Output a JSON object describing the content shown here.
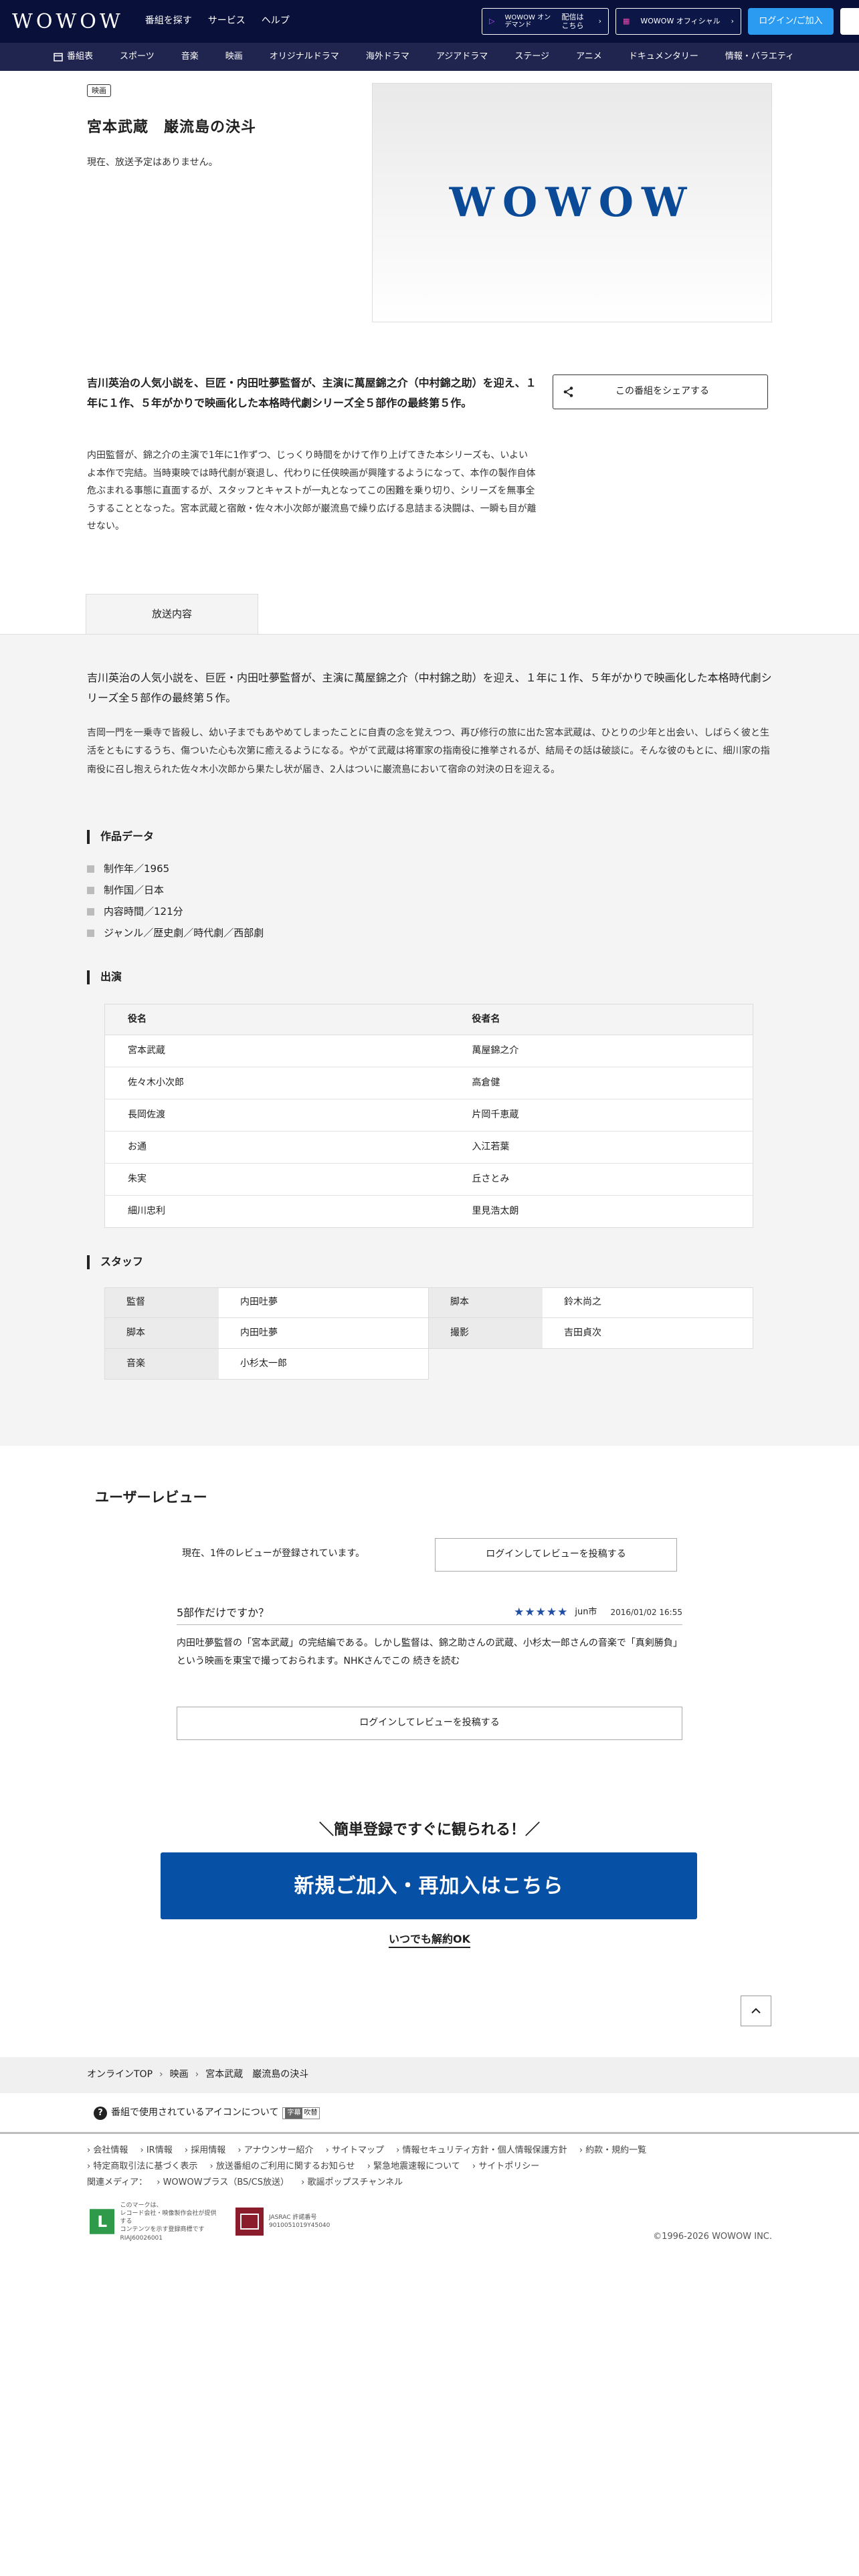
{
  "header": {
    "logo": "WOWOW",
    "nav": [
      "番組を探す",
      "サービス",
      "ヘルプ"
    ],
    "ondemand_brand": "WOWOW オンデマンド",
    "ondemand_label": "配信は\nこちら",
    "shop_label": "WOWOW オフィシャル",
    "login_label": "ログイン/ご加入"
  },
  "subnav": [
    "番組表",
    "スポーツ",
    "音楽",
    "映画",
    "オリジナルドラマ",
    "海外ドラマ",
    "アジアドラマ",
    "ステージ",
    "アニメ",
    "ドキュメンタリー",
    "情報・バラエティ"
  ],
  "program": {
    "genre_tag": "映画",
    "title": "宮本武蔵　巌流島の決斗",
    "schedule": "現在、放送予定はありません。",
    "hero_logo": "WOWOW",
    "lead": "吉川英治の人気小説を、巨匠・内田吐夢監督が、主演に萬屋錦之介（中村錦之助）を迎え、１年に１作、５年がかりで映画化した本格時代劇シリーズ全５部作の最終第５作。",
    "body": "内田監督が、錦之介の主演で1年に1作ずつ、じっくり時間をかけて作り上げてきた本シリーズも、いよいよ本作で完結。当時東映では時代劇が衰退し、代わりに任侠映画が興隆するようになって、本作の製作自体危ぶまれる事態に直面するが、スタッフとキャストが一丸となってこの困難を乗り切り、シリーズを無事全うすることとなった。宮本武蔵と宿敵・佐々木小次郎が巌流島で繰り広げる息詰まる決闘は、一瞬も目が離せない。",
    "share_label": "この番組をシェアする",
    "tab_label": "放送内容"
  },
  "detail": {
    "intro_lead": "吉川英治の人気小説を、巨匠・内田吐夢監督が、主演に萬屋錦之介（中村錦之助）を迎え、１年に１作、５年がかりで映画化した本格時代劇シリーズ全５部作の最終第５作。",
    "intro_body": "吉岡一門を一乗寺で皆殺し、幼い子までもあやめてしまったことに自責の念を覚えつつ、再び修行の旅に出た宮本武蔵は、ひとりの少年と出会い、しばらく彼と生活をともにするうち、傷ついた心も次第に癒えるようになる。やがて武蔵は将軍家の指南役に推挙されるが、結局その話は破談に。そんな彼のもとに、細川家の指南役に召し抱えられた佐々木小次郎から果たし状が届き、2人はついに巌流島において宿命の対決の日を迎える。",
    "works_heading": "作品データ",
    "works": [
      "制作年／1965",
      "制作国／日本",
      "内容時間／121分",
      "ジャンル／歴史劇／時代劇／西部劇"
    ],
    "cast_heading": "出演",
    "cast_cols": [
      "役名",
      "役者名"
    ],
    "cast": [
      [
        "宮本武蔵",
        "萬屋錦之介"
      ],
      [
        "佐々木小次郎",
        "高倉健"
      ],
      [
        "長岡佐渡",
        "片岡千恵蔵"
      ],
      [
        "お通",
        "入江若葉"
      ],
      [
        "朱実",
        "丘さとみ"
      ],
      [
        "細川忠利",
        "里見浩太朗"
      ]
    ],
    "staff_heading": "スタッフ",
    "staff": [
      [
        "監督",
        "内田吐夢",
        "脚本",
        "鈴木尚之"
      ],
      [
        "脚本",
        "内田吐夢",
        "撮影",
        "吉田貞次"
      ],
      [
        "音楽",
        "小杉太一郎",
        "",
        ""
      ]
    ]
  },
  "reviews": {
    "heading": "ユーザーレビュー",
    "count_text": "現在、1件のレビューが登録されています。",
    "post_button": "ログインしてレビューを投稿する",
    "items": [
      {
        "title": "5部作だけですか？",
        "stars": "★★★★★",
        "user": "jun市",
        "date": "2016/01/02 16:55",
        "text": "内田吐夢監督の「宮本武蔵」の完結編である。しかし監督は、錦之助さんの武蔵、小杉太一郎さんの音楽で「真剣勝負」という映画を東宝で撮っておられます。NHKさんでこの",
        "more": "続きを読む"
      }
    ]
  },
  "join": {
    "catch": "＼簡単登録ですぐに観られる！／",
    "button": "新規ご加入・再加入はこちら",
    "cancel": "いつでも解約OK"
  },
  "footer": {
    "breadcrumb": [
      "オンラインTOP",
      "映画",
      "宮本武蔵　巌流島の決斗"
    ],
    "icon_note": "番組で使用されているアイコンについて",
    "icon_mini_a": "字幕",
    "icon_mini_b": "吹替",
    "links": [
      "会社情報",
      "IR情報",
      "採用情報",
      "アナウンサー紹介",
      "サイトマップ",
      "情報セキュリティ方針・個人情報保護方針",
      "約款・規約一覧",
      "特定商取引法に基づく表示",
      "放送番組のご利用に関するお知らせ",
      "緊急地震速報について",
      "サイトポリシー"
    ],
    "related_label": "関連メディア：",
    "related": [
      "WOWOWプラス（BS/CS放送）",
      "歌謡ポップスチャンネル"
    ],
    "badge1": "このマークは、\nレコード会社・映像製作会社が提供する\nコンテンツを示す登録商標です\nRIAJ60026001",
    "badge2": "JASRAC 許諾番号\n9010051019Y45040",
    "copyright": "©1996-2026 WOWOW INC."
  }
}
